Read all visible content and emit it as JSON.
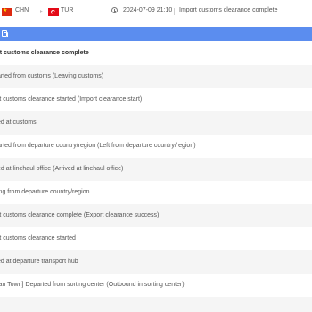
{
  "header": {
    "origin_code": "CHN",
    "destination_code": "TUR",
    "timestamp": "2024-07-09 21:10",
    "latest_status": "Import customs clearance complete",
    "colors": {
      "china_flag": "#de2910",
      "turkey_flag": "#e30a17",
      "accent_bar": "#5b8def"
    }
  },
  "events": [
    "rt customs clearance complete",
    "arted from customs (Leaving customs)",
    "rt customs clearance started (Import clearance start)",
    "ed at customs",
    "arted from departure country/region (Left from departure country/region)",
    "ed at linehaul office (Arrived at linehaul office)",
    "ing from departure country/region",
    "rt customs clearance complete (Export clearance success)",
    "rt customs clearance started",
    "ed at departure transport hub",
    "ian Town] Departed from sorting center (Outbound in sorting center)"
  ]
}
